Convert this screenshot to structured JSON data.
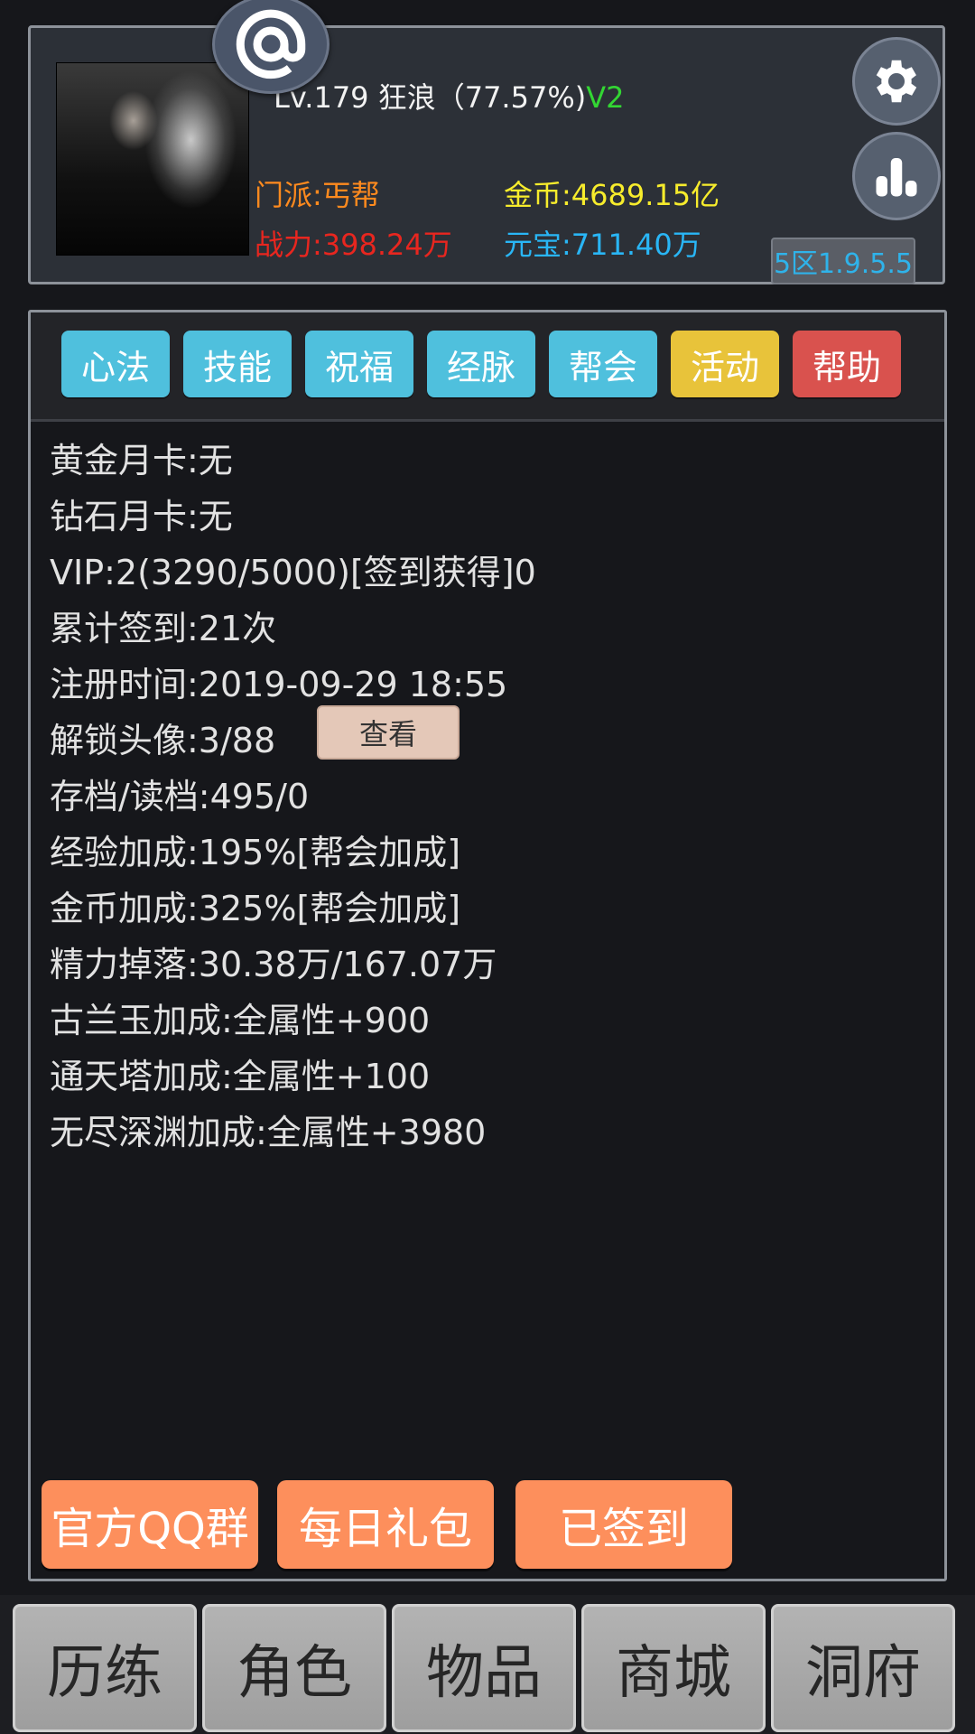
{
  "header": {
    "level_text": "Lv.179 狂浪（77.57%)",
    "vip_mark": "V2",
    "sect": "门派:丐帮",
    "power": "战力:398.24万",
    "gold": "金币:4689.15亿",
    "yuanbao": "元宝:711.40万",
    "server": "5区1.9.5.5",
    "colors": {
      "sect": "#ff8a1e",
      "power": "#e8261f",
      "gold": "#f7ec2c",
      "yuanbao": "#29b6f6",
      "vip": "#33d633"
    }
  },
  "tabs": [
    {
      "label": "心法",
      "color": "#4fc0dd"
    },
    {
      "label": "技能",
      "color": "#4fc0dd"
    },
    {
      "label": "祝福",
      "color": "#4fc0dd"
    },
    {
      "label": "经脉",
      "color": "#4fc0dd"
    },
    {
      "label": "帮会",
      "color": "#4fc0dd"
    },
    {
      "label": "活动",
      "color": "#e8c33a"
    },
    {
      "label": "帮助",
      "color": "#d9524e"
    }
  ],
  "info": [
    "黄金月卡:无",
    "钻石月卡:无",
    "VIP:2(3290/5000)[签到获得]0",
    "累计签到:21次",
    "注册时间:2019-09-29 18:55",
    "解锁头像:3/88",
    "存档/读档:495/0",
    "经验加成:195%[帮会加成]",
    "金币加成:325%[帮会加成]",
    "精力掉落:30.38万/167.07万",
    "古兰玉加成:全属性+900",
    "通天塔加成:全属性+100",
    "无尽深渊加成:全属性+3980"
  ],
  "view_button": "查看",
  "actions": {
    "qq_group": "官方QQ群",
    "daily_gift": "每日礼包",
    "signed_in": "已签到"
  },
  "nav": [
    "历练",
    "角色",
    "物品",
    "商城",
    "洞府"
  ]
}
